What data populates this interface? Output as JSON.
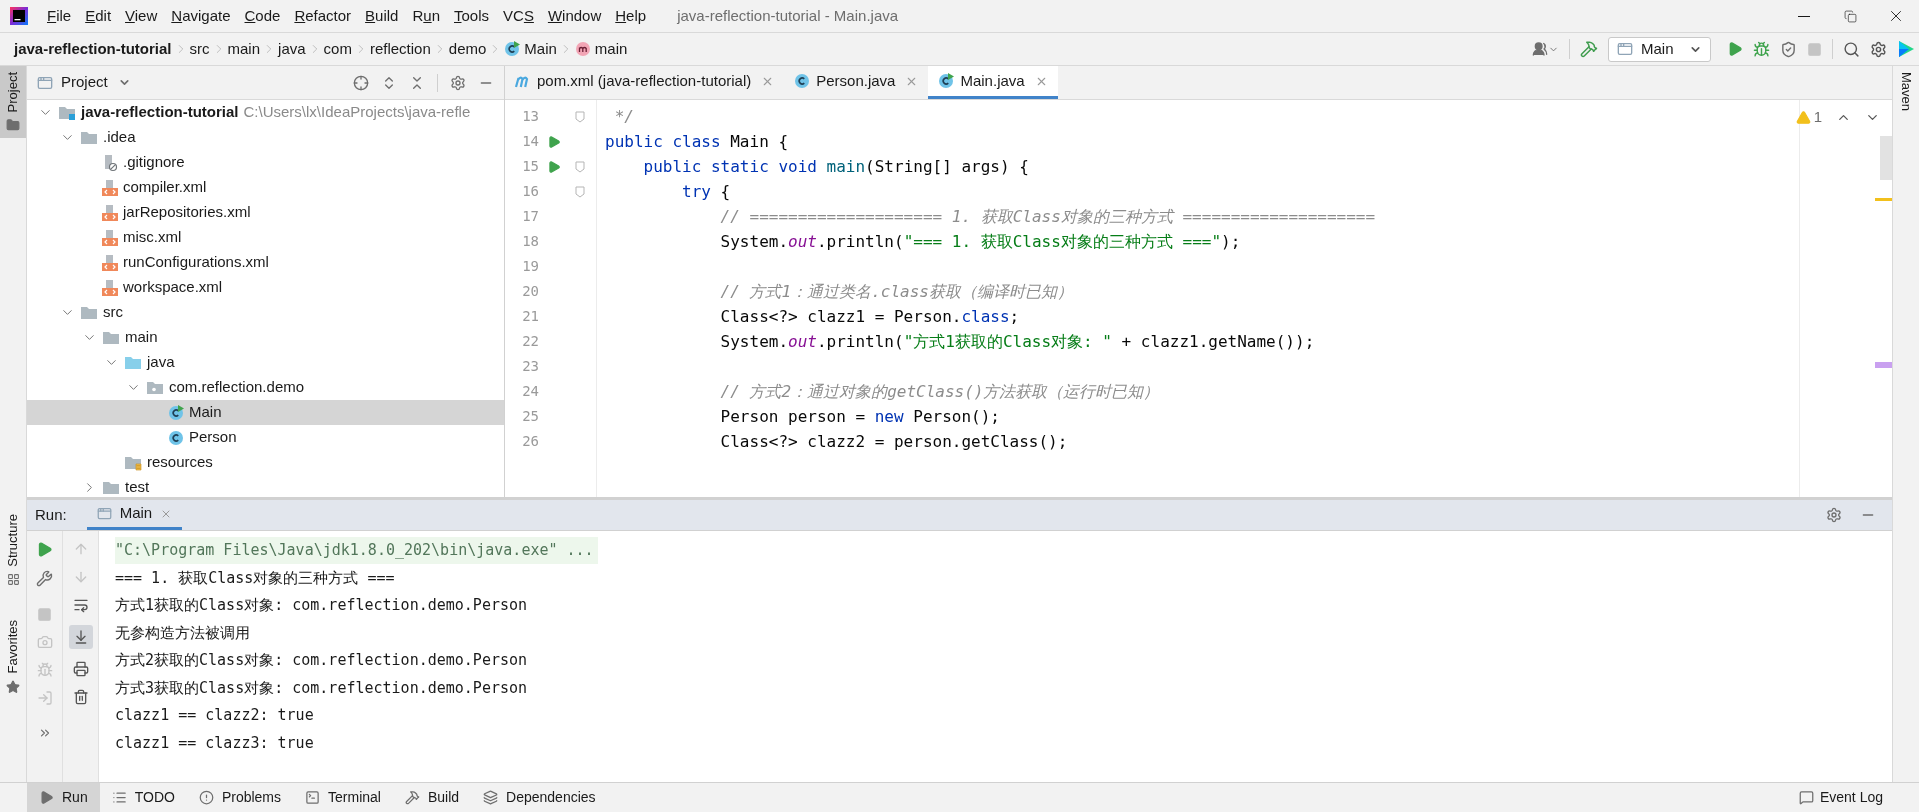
{
  "title_bar": {
    "menu": [
      {
        "key": "F",
        "after": "ile"
      },
      {
        "key": "E",
        "after": "dit"
      },
      {
        "key": "V",
        "after": "iew"
      },
      {
        "key": "N",
        "after": "avigate"
      },
      {
        "key": "C",
        "after": "ode"
      },
      {
        "key": "R",
        "after": "efactor"
      },
      {
        "key": "B",
        "after": "uild"
      },
      {
        "before": "R",
        "key": "u",
        "after": "n"
      },
      {
        "key": "T",
        "after": "ools"
      },
      {
        "before": "VC",
        "key": "S"
      },
      {
        "key": "W",
        "after": "indow"
      },
      {
        "key": "H",
        "after": "elp"
      }
    ],
    "title": "java-reflection-tutorial - Main.java"
  },
  "breadcrumbs": [
    {
      "label": "java-reflection-tutorial",
      "kind": "project"
    },
    {
      "label": "src",
      "kind": "folder"
    },
    {
      "label": "main",
      "kind": "folder"
    },
    {
      "label": "java",
      "kind": "folder"
    },
    {
      "label": "com",
      "kind": "folder"
    },
    {
      "label": "reflection",
      "kind": "folder"
    },
    {
      "label": "demo",
      "kind": "folder"
    },
    {
      "label": "Main",
      "kind": "class"
    },
    {
      "label": "main",
      "kind": "method"
    }
  ],
  "run_configuration": "Main",
  "left_stripe": [
    {
      "label": "Project",
      "selected": true,
      "kind": "project"
    },
    {
      "label": "Structure",
      "selected": false,
      "kind": "structure"
    },
    {
      "label": "Favorites",
      "selected": false,
      "kind": "favorites"
    }
  ],
  "right_stripe": [
    {
      "label": "Maven"
    }
  ],
  "project_panel": {
    "title": "Project",
    "tree": [
      {
        "label": "java-reflection-tutorial",
        "hint": "C:\\Users\\lx\\IdeaProjects\\java-refle",
        "kind": "project",
        "expanded": true,
        "selected": false,
        "children": [
          {
            "label": ".idea",
            "kind": "folder",
            "expanded": true,
            "selected": false,
            "children": [
              {
                "label": ".gitignore",
                "kind": "ignore",
                "selected": false
              },
              {
                "label": "compiler.xml",
                "kind": "xml",
                "selected": false
              },
              {
                "label": "jarRepositories.xml",
                "kind": "xml",
                "selected": false
              },
              {
                "label": "misc.xml",
                "kind": "xml",
                "selected": false
              },
              {
                "label": "runConfigurations.xml",
                "kind": "xml",
                "selected": false
              },
              {
                "label": "workspace.xml",
                "kind": "xml",
                "selected": false
              }
            ]
          },
          {
            "label": "src",
            "kind": "folder",
            "expanded": true,
            "selected": false,
            "children": [
              {
                "label": "main",
                "kind": "folder",
                "expanded": true,
                "selected": false,
                "children": [
                  {
                    "label": "java",
                    "kind": "source_folder",
                    "expanded": true,
                    "selected": false,
                    "children": [
                      {
                        "label": "com.reflection.demo",
                        "kind": "package",
                        "expanded": true,
                        "selected": false,
                        "children": [
                          {
                            "label": "Main",
                            "kind": "main_class",
                            "selected": true
                          },
                          {
                            "label": "Person",
                            "kind": "class",
                            "selected": false
                          }
                        ]
                      }
                    ]
                  },
                  {
                    "label": "resources",
                    "kind": "resources",
                    "selected": false
                  }
                ]
              },
              {
                "label": "test",
                "kind": "folder",
                "expanded": false,
                "selected": false
              }
            ]
          }
        ]
      }
    ]
  },
  "editor": {
    "tabs": [
      {
        "label": "pom.xml (java-reflection-tutorial)",
        "kind": "maven",
        "selected": false
      },
      {
        "label": "Person.java",
        "kind": "class",
        "selected": false
      },
      {
        "label": "Main.java",
        "kind": "main_class",
        "selected": true
      }
    ],
    "warning_count": "1",
    "lines": [
      {
        "number": "13",
        "run": false,
        "fold": true,
        "tokens": [
          {
            "kind": "comment",
            "text": " */"
          }
        ]
      },
      {
        "number": "14",
        "run": true,
        "fold": false,
        "tokens": [
          {
            "kind": "keyword",
            "text": "public class "
          },
          {
            "kind": "plain",
            "text": "Main {"
          }
        ]
      },
      {
        "number": "15",
        "run": true,
        "fold": true,
        "tokens": [
          {
            "kind": "keyword",
            "text": "    public static void "
          },
          {
            "kind": "method",
            "text": "main"
          },
          {
            "kind": "plain",
            "text": "(String[] args) {"
          }
        ]
      },
      {
        "number": "16",
        "run": false,
        "fold": true,
        "tokens": [
          {
            "kind": "keyword",
            "text": "        try"
          },
          {
            "kind": "plain",
            "text": " {"
          }
        ]
      },
      {
        "number": "17",
        "run": false,
        "fold": false,
        "tokens": [
          {
            "kind": "comment",
            "text": "            // ==================== 1. 获取Class对象的三种方式 ===================="
          }
        ]
      },
      {
        "number": "18",
        "run": false,
        "fold": false,
        "tokens": [
          {
            "kind": "plain",
            "text": "            System."
          },
          {
            "kind": "field",
            "text": "out"
          },
          {
            "kind": "plain",
            "text": ".println("
          },
          {
            "kind": "string",
            "text": "\"=== 1. 获取Class对象的三种方式 ===\""
          },
          {
            "kind": "plain",
            "text": ");"
          }
        ]
      },
      {
        "number": "19",
        "run": false,
        "fold": false
      },
      {
        "number": "20",
        "run": false,
        "fold": false,
        "tokens": [
          {
            "kind": "comment",
            "text": "            // 方式1：通过类名.class获取（编译时已知）"
          }
        ]
      },
      {
        "number": "21",
        "run": false,
        "fold": false,
        "tokens": [
          {
            "kind": "plain",
            "text": "            Class<?> clazz1 = Person."
          },
          {
            "kind": "keyword",
            "text": "class"
          },
          {
            "kind": "plain",
            "text": ";"
          }
        ]
      },
      {
        "number": "22",
        "run": false,
        "fold": false,
        "tokens": [
          {
            "kind": "plain",
            "text": "            System."
          },
          {
            "kind": "field",
            "text": "out"
          },
          {
            "kind": "plain",
            "text": ".println("
          },
          {
            "kind": "string",
            "text": "\"方式1获取的Class对象: \""
          },
          {
            "kind": "plain",
            "text": " + clazz1.getName());"
          }
        ]
      },
      {
        "number": "23",
        "run": false,
        "fold": false
      },
      {
        "number": "24",
        "run": false,
        "fold": false,
        "tokens": [
          {
            "kind": "comment",
            "text": "            // 方式2：通过对象的getClass()方法获取（运行时已知）"
          }
        ]
      },
      {
        "number": "25",
        "run": false,
        "fold": false,
        "tokens": [
          {
            "kind": "plain",
            "text": "            Person person = "
          },
          {
            "kind": "keyword",
            "text": "new"
          },
          {
            "kind": "plain",
            "text": " Person();"
          }
        ]
      },
      {
        "number": "26",
        "run": false,
        "fold": false,
        "tokens": [
          {
            "kind": "plain",
            "text": "            Class<?> clazz2 = person.getClass();"
          }
        ]
      }
    ]
  },
  "run_panel": {
    "label": "Run:",
    "tabs": [
      {
        "label": "Main",
        "selected": true
      }
    ],
    "output": [
      {
        "kind": "command",
        "text": "\"C:\\Program Files\\Java\\jdk1.8.0_202\\bin\\java.exe\" ..."
      },
      {
        "kind": "stdout",
        "text": "=== 1. 获取Class对象的三种方式 ==="
      },
      {
        "kind": "stdout",
        "text": "方式1获取的Class对象: com.reflection.demo.Person"
      },
      {
        "kind": "stdout",
        "text": "无参构造方法被调用"
      },
      {
        "kind": "stdout",
        "text": "方式2获取的Class对象: com.reflection.demo.Person"
      },
      {
        "kind": "stdout",
        "text": "方式3获取的Class对象: com.reflection.demo.Person"
      },
      {
        "kind": "stdout",
        "text": "clazz1 == clazz2: true"
      },
      {
        "kind": "stdout",
        "text": "clazz1 == clazz3: true"
      }
    ]
  },
  "bottom_bar": {
    "tools": [
      {
        "label": "Run",
        "kind": "run",
        "selected": true
      },
      {
        "label": "TODO",
        "kind": "todo",
        "selected": false
      },
      {
        "label": "Problems",
        "kind": "problems",
        "selected": false
      },
      {
        "label": "Terminal",
        "kind": "terminal",
        "selected": false
      },
      {
        "label": "Build",
        "kind": "build",
        "selected": false
      },
      {
        "label": "Dependencies",
        "kind": "dependencies",
        "selected": false
      }
    ],
    "event_log": "Event Log"
  }
}
